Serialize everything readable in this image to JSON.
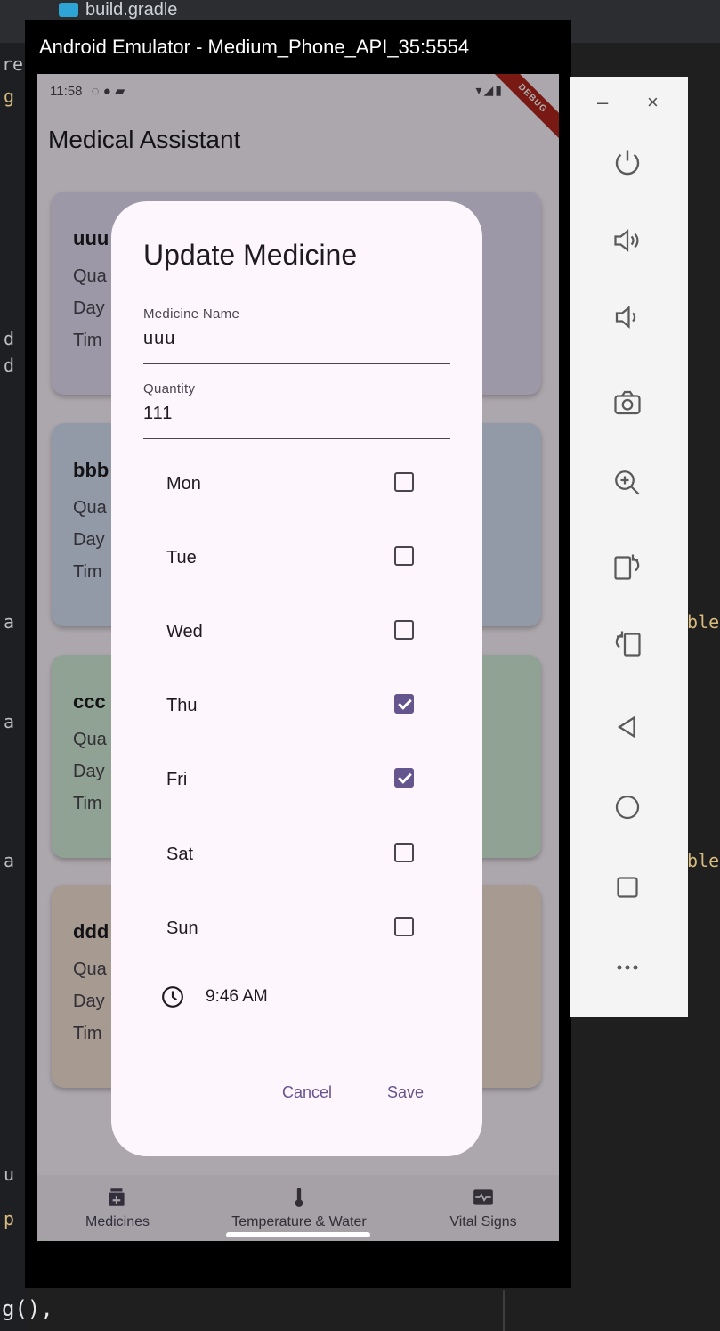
{
  "ide": {
    "tab_label": "build.gradle",
    "left_fragments": [
      "re",
      "g",
      "d",
      "d",
      "a",
      "a",
      "a",
      "u",
      "p"
    ],
    "right_fragments": [
      "ble",
      "ble"
    ],
    "bottom_code": "g(),"
  },
  "emulator": {
    "window_title": "Android Emulator - Medium_Phone_API_35:5554",
    "status_time": "11:58",
    "debug_banner": "DEBUG"
  },
  "app": {
    "title": "Medical Assistant",
    "cards": [
      {
        "title": "uuu",
        "color": "#e6e0f8",
        "lines": [
          "Qua",
          "Day",
          "Tim"
        ]
      },
      {
        "title": "bbb",
        "color": "#d9e4f7",
        "lines": [
          "Qua",
          "Day",
          "Tim"
        ]
      },
      {
        "title": "ccc",
        "color": "#d3efd9",
        "lines": [
          "Qua",
          "Day",
          "Tim"
        ]
      },
      {
        "title": "ddd",
        "color": "#f5e3d6",
        "lines": [
          "Qua",
          "Day",
          "Tim"
        ]
      }
    ],
    "nav": [
      {
        "label": "Medicines",
        "icon": "medication-icon",
        "active": true
      },
      {
        "label": "Temperature & Water",
        "icon": "thermometer-icon",
        "active": false
      },
      {
        "label": "Vital Signs",
        "icon": "monitor-heart-icon",
        "active": false
      }
    ]
  },
  "dialog": {
    "title": "Update Medicine",
    "name_label": "Medicine Name",
    "name_value": "uuu",
    "quantity_label": "Quantity",
    "quantity_value": "111",
    "days": [
      {
        "label": "Mon",
        "checked": false
      },
      {
        "label": "Tue",
        "checked": false
      },
      {
        "label": "Wed",
        "checked": false
      },
      {
        "label": "Thu",
        "checked": true
      },
      {
        "label": "Fri",
        "checked": true
      },
      {
        "label": "Sat",
        "checked": false
      },
      {
        "label": "Sun",
        "checked": false
      }
    ],
    "time": "9:46 AM",
    "cancel_label": "Cancel",
    "save_label": "Save"
  },
  "toolbar": {
    "minimize_label": "–",
    "close_label": "×",
    "items": [
      "power-icon",
      "volume-up-icon",
      "volume-down-icon",
      "camera-icon",
      "zoom-icon",
      "rotate-right-icon",
      "rotate-left-icon",
      "back-icon",
      "home-icon",
      "overview-icon",
      "more-icon"
    ]
  },
  "colors": {
    "accent": "#65558f",
    "dialog_bg": "#fdf6fc",
    "debug_red": "#b3261e"
  }
}
